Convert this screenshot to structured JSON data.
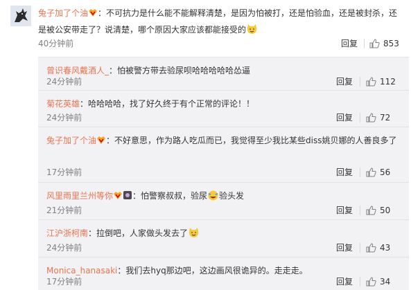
{
  "top": {
    "username": "兔子加了个油",
    "content": "：不可抗力是什么能不能解释清楚，是因为怕被打，还是怕验血，还是被封杀，还是被公安带走了？说清楚，哪个原因大家应该都能接受的",
    "time": "40分钟前",
    "reply_label": "回复",
    "likes": "853"
  },
  "replies": [
    {
      "username": "曾识春风戴酒人_",
      "content": "：怕被警方带去验尿呗哈哈哈哈哈怂逼",
      "time": "24分钟前",
      "reply_label": "回复",
      "likes": "112"
    },
    {
      "username": "菊花英雄",
      "content": "：哈哈哈哈，找了好久终于有个正常的评论！！",
      "time": "24分钟前",
      "reply_label": "回复",
      "likes": "72"
    },
    {
      "username": "兔子加了个油",
      "content": "：不好意思，作为路人吃瓜而已，我觉得至少我比某些diss姚贝娜的人善良多了",
      "time": "17分钟前",
      "reply_label": "回复",
      "likes": "56"
    },
    {
      "username": "风里雨里兰州等你",
      "content": "：怕警察叔叔，验尿",
      "content_tail": "验头发",
      "time": "21分钟前",
      "reply_label": "回复",
      "likes": "50"
    },
    {
      "username": "江沪浙柯南",
      "content": "：拉倒吧，人家做头发去了",
      "time": "24分钟前",
      "reply_label": "回复",
      "likes": "43"
    },
    {
      "username": "Monica_hanasaki",
      "content": "：我们去hyq那边吧，这边画风很诡异的。走走走。",
      "time": "17分钟前",
      "reply_label": "回复",
      "likes": "34"
    }
  ],
  "colors": {
    "username": "#eb7350",
    "reply_username": "#eb7350",
    "meta": "#808080",
    "reply_bg": "#f2f2f5"
  },
  "icons": [
    "avatar-cat-image",
    "vip-badge",
    "thumb-up-icon",
    "smirk-cat-emoji",
    "laugh-cry-emoji",
    "square-badge-icon"
  ]
}
